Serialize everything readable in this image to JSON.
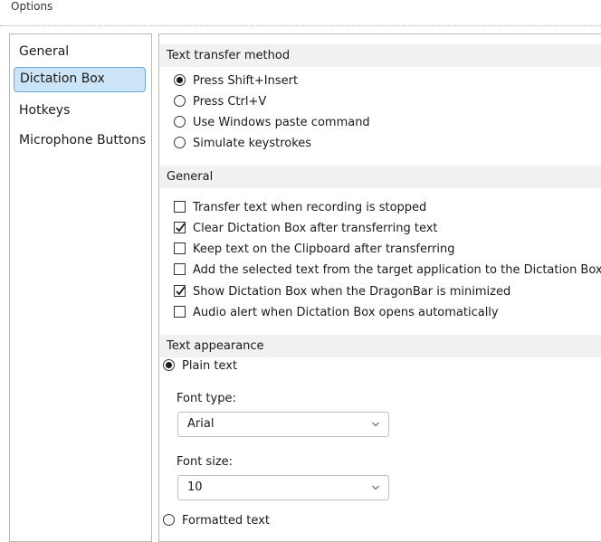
{
  "window": {
    "title": "Options"
  },
  "sidebar": {
    "items": [
      {
        "label": "General"
      },
      {
        "label": "Dictation Box"
      },
      {
        "label": "Hotkeys"
      },
      {
        "label": "Microphone Buttons"
      }
    ],
    "selected": "Dictation Box"
  },
  "transfer": {
    "header": "Text transfer method",
    "options": [
      {
        "label": "Press Shift+Insert",
        "checked": true
      },
      {
        "label": "Press Ctrl+V",
        "checked": false
      },
      {
        "label": "Use Windows paste command",
        "checked": false
      },
      {
        "label": "Simulate keystrokes",
        "checked": false
      }
    ]
  },
  "general": {
    "header": "General",
    "options": [
      {
        "label": "Transfer text when recording is stopped",
        "checked": false
      },
      {
        "label": "Clear Dictation Box after transferring text",
        "checked": true
      },
      {
        "label": "Keep text on the Clipboard after transferring",
        "checked": false
      },
      {
        "label": "Add the selected text from the target application to the Dictation Box",
        "checked": false
      },
      {
        "label": "Show Dictation Box when the DragonBar is minimized",
        "checked": true
      },
      {
        "label": "Audio alert when Dictation Box opens automatically",
        "checked": false
      }
    ]
  },
  "appearance": {
    "header": "Text appearance",
    "plain_text": {
      "label": "Plain text",
      "checked": true
    },
    "font_type": {
      "label": "Font type:",
      "value": "Arial"
    },
    "font_size": {
      "label": "Font size:",
      "value": "10"
    },
    "formatted_text": {
      "label": "Formatted text",
      "checked": false
    }
  },
  "icons": {
    "check": "checkmark-icon",
    "dropdown": "chevron-down-icon"
  }
}
